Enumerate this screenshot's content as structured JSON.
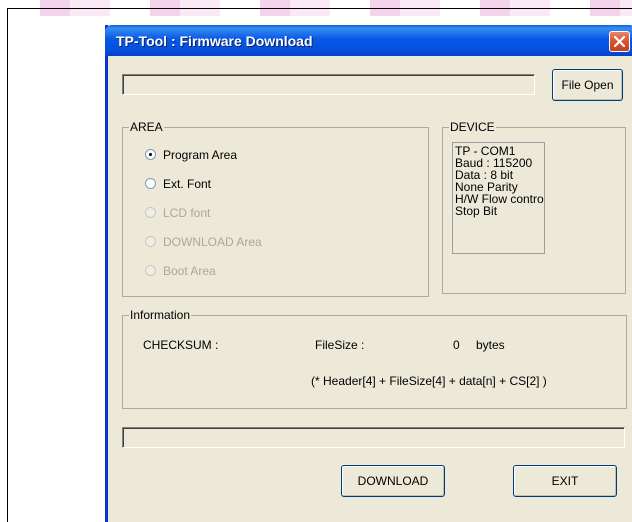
{
  "window": {
    "title": "TP-Tool : Firmware Download",
    "close_icon": "close-icon"
  },
  "file": {
    "path_value": "",
    "open_button": "File Open"
  },
  "area": {
    "label": "AREA",
    "options": [
      {
        "label": "Program Area",
        "selected": true,
        "enabled": true
      },
      {
        "label": "Ext. Font",
        "selected": false,
        "enabled": true
      },
      {
        "label": "LCD font",
        "selected": false,
        "enabled": false
      },
      {
        "label": "DOWNLOAD Area",
        "selected": false,
        "enabled": false
      },
      {
        "label": "Boot Area",
        "selected": false,
        "enabled": false
      }
    ]
  },
  "device": {
    "label": "DEVICE",
    "lines": [
      "TP - COM1",
      "Baud : 115200",
      "Data : 8 bit",
      "None Parity",
      "H/W Flow controlOne",
      "Stop Bit"
    ]
  },
  "information": {
    "label": "Information",
    "checksum_label": "CHECKSUM :",
    "filesize_label": "FileSize :",
    "filesize_value": "0",
    "filesize_unit": "bytes",
    "formula": "(* Header[4] + FileSize[4] + data[n] + CS[2] )"
  },
  "progress": {
    "value": 0
  },
  "buttons": {
    "download": "DOWNLOAD",
    "exit": "EXIT"
  },
  "colors": {
    "titlebar": "#0858e6",
    "dialog_bg": "#ece9d8",
    "close_button": "#d9532e"
  }
}
